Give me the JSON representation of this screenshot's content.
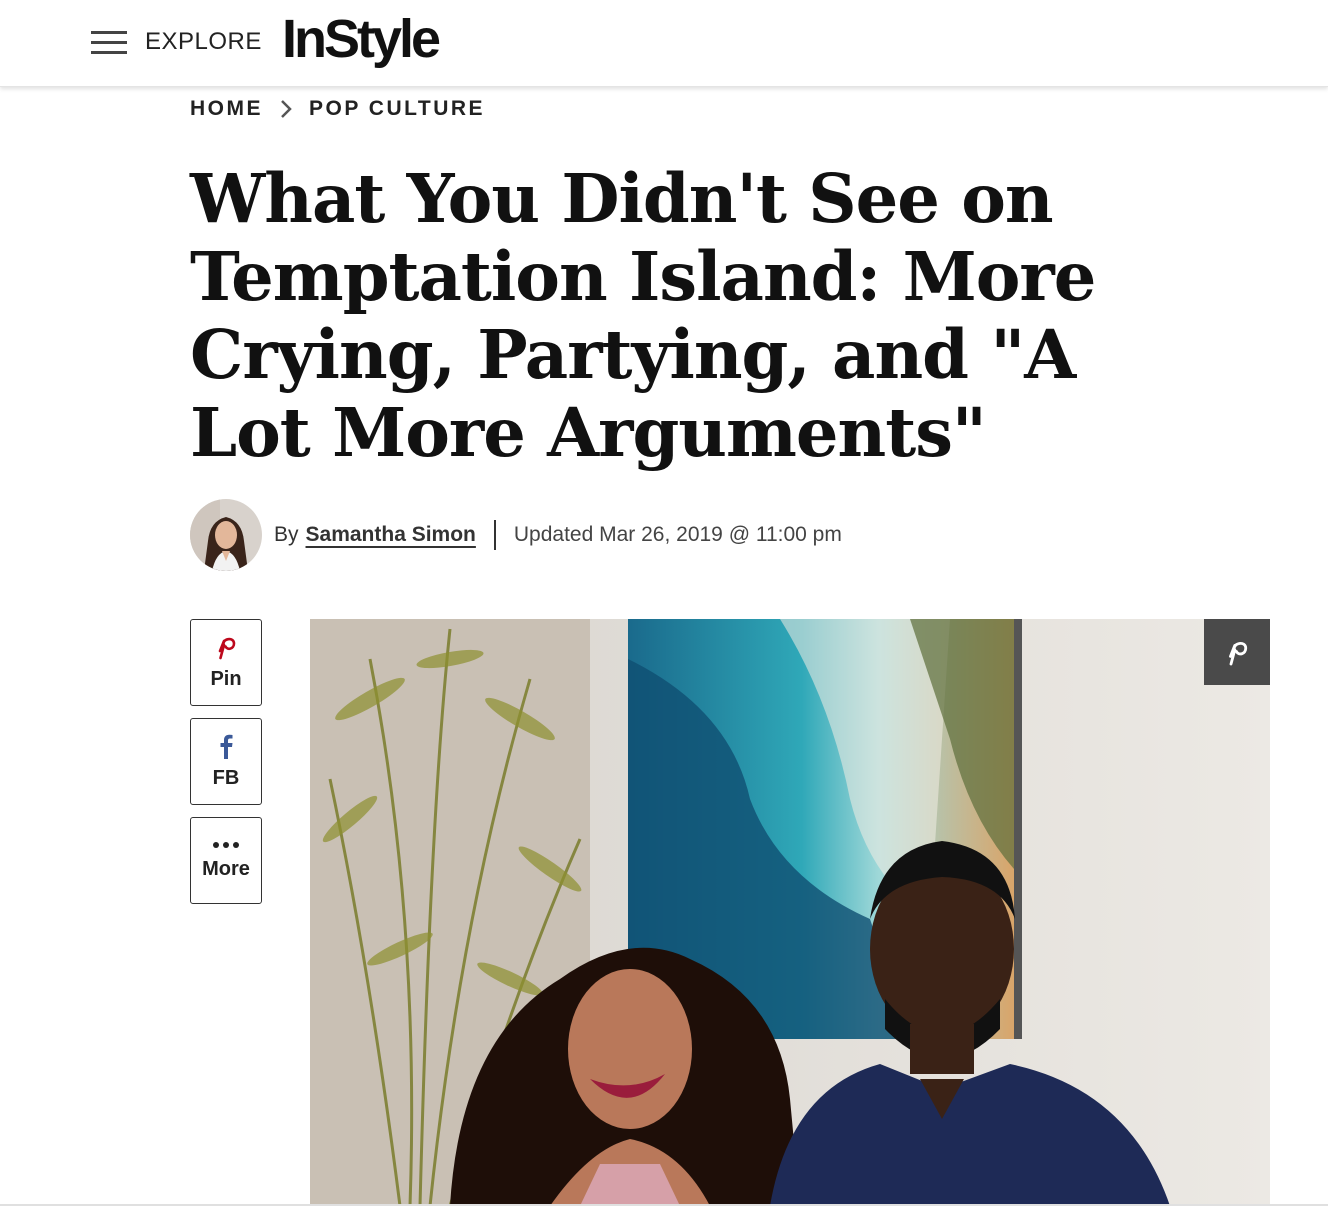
{
  "header": {
    "explore_label": "EXPLORE",
    "logo_text": "InStyle"
  },
  "breadcrumb": {
    "items": [
      {
        "label": "HOME"
      },
      {
        "label": "POP CULTURE"
      }
    ]
  },
  "article": {
    "title": "What You Didn't See on Temptation Island: More Crying, Partying, and \"A Lot More Arguments\"",
    "byline_prefix": "By",
    "author": "Samantha Simon",
    "updated": "Updated Mar 26, 2019 @ 11:00 pm"
  },
  "share": {
    "pin_label": "Pin",
    "fb_label": "FB",
    "more_label": "More"
  },
  "colors": {
    "pinterest": "#bd081c",
    "facebook": "#3b5998",
    "overlay": "#4a4a4a"
  }
}
